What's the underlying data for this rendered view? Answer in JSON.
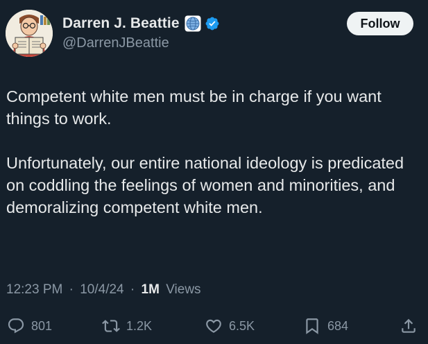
{
  "author": {
    "display_name": "Darren J. Beattie",
    "handle": "@DarrenJBeattie",
    "avatar_icon": "cartoon-man-reading-icon",
    "affiliation_icon": "globe-icon",
    "verified_icon": "verified-badge-icon",
    "verified_color": "#1d9bf0"
  },
  "follow_label": "Follow",
  "text": {
    "paragraph_1": "Competent white men must be in charge if you want things to work.",
    "paragraph_2": "Unfortunately, our entire national ideology is predicated on coddling the feelings of women and minorities, and demoralizing competent white men."
  },
  "meta": {
    "time": "12:23 PM",
    "separator": "·",
    "date": "10/4/24",
    "views_count": "1M",
    "views_label": "Views"
  },
  "actions": {
    "replies": "801",
    "reposts": "1.2K",
    "likes": "6.5K",
    "bookmarks": "684"
  },
  "colors": {
    "background": "#15202b",
    "text_primary": "#e7e9ea",
    "text_secondary": "#8b98a5",
    "follow_bg": "#eff3f4"
  }
}
